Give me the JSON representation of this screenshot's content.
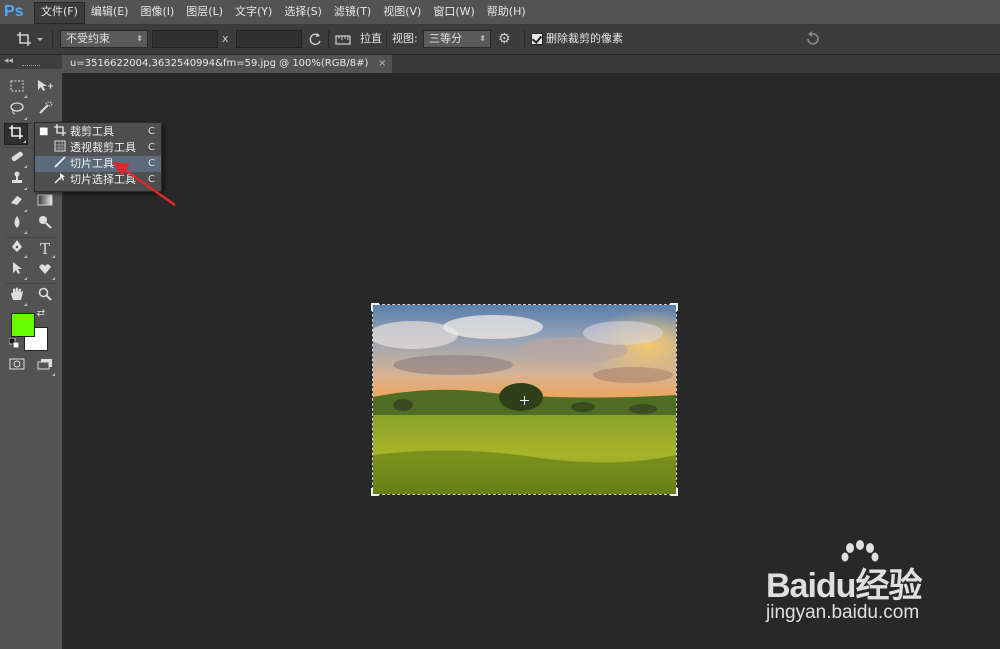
{
  "app": {
    "logo": "Ps"
  },
  "menu": [
    "文件(F)",
    "编辑(E)",
    "图像(I)",
    "图层(L)",
    "文字(Y)",
    "选择(S)",
    "滤镜(T)",
    "视图(V)",
    "窗口(W)",
    "帮助(H)"
  ],
  "options": {
    "ratio_select": "不受约束",
    "x_sep": "x",
    "straighten_label": "拉直",
    "view_label": "视图:",
    "view_select": "三等分",
    "delete_checkbox_label": "删除裁剪的像素",
    "delete_checked": true
  },
  "document": {
    "tab_title": "u=3516622004,3632540994&fm=59.jpg @ 100%(RGB/8#)",
    "close_symbol": "×"
  },
  "flyout": {
    "items": [
      {
        "label": "裁剪工具",
        "key": "C",
        "icon": "crop-icon",
        "active": true
      },
      {
        "label": "透视裁剪工具",
        "key": "C",
        "icon": "perspective-crop-icon",
        "active": false
      },
      {
        "label": "切片工具",
        "key": "C",
        "icon": "slice-icon",
        "active": false,
        "highlighted": true
      },
      {
        "label": "切片选择工具",
        "key": "C",
        "icon": "slice-select-icon",
        "active": false
      }
    ]
  },
  "colors": {
    "foreground": "#66ff00",
    "background": "#ffffff",
    "annotation_arrow": "#e0262e"
  },
  "watermark": {
    "brand": "Baidu经验",
    "url": "jingyan.baidu.com"
  }
}
